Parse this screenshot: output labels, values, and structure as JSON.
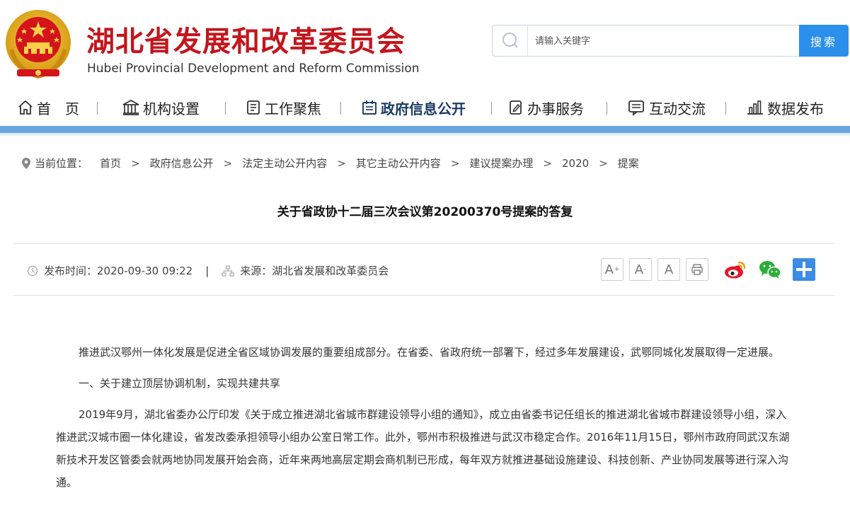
{
  "site": {
    "title": "湖北省发展和改革委员会",
    "subtitle": "Hubei Provincial Development and Reform Commission"
  },
  "search": {
    "placeholder": "请输入关键字",
    "button_label": "搜索"
  },
  "nav": {
    "items": [
      {
        "label": "首　页",
        "icon": "home-icon"
      },
      {
        "label": "机构设置",
        "icon": "building-icon"
      },
      {
        "label": "工作聚焦",
        "icon": "document-icon"
      },
      {
        "label": "政府信息公开",
        "icon": "calendar-icon",
        "active": true
      },
      {
        "label": "办事服务",
        "icon": "edit-icon"
      },
      {
        "label": "互动交流",
        "icon": "chat-icon"
      },
      {
        "label": "数据发布",
        "icon": "bar-chart-icon"
      }
    ]
  },
  "breadcrumb": {
    "label": "当前位置：",
    "items": [
      "首页",
      "政府信息公开",
      "法定主动公开内容",
      "其它主动公开内容",
      "建议提案办理",
      "2020",
      "提案"
    ],
    "separator": ">"
  },
  "article": {
    "title": "关于省政协十二届三次会议第20200370号提案的答复",
    "publish_label": "发布时间：",
    "publish_time": "2020-09-30 09:22",
    "meta_separator": "|",
    "source_label": "来源：",
    "source": "湖北省发展和改革委员会",
    "paragraphs": [
      "推进武汉鄂州一体化发展是促进全省区域协调发展的重要组成部分。在省委、省政府统一部署下，经过多年发展建设，武鄂同城化发展取得一定进展。",
      "一、关于建立顶层协调机制，实现共建共享",
      "2019年9月，湖北省委办公厅印发《关于成立推进湖北省城市群建设领导小组的通知》，成立由省委书记任组长的推进湖北省城市群建设领导小组，深入推进武汉城市圈一体化建设，省发改委承担领导小组办公室日常工作。此外，鄂州市积极推进与武汉市稳定合作。2016年11月15日，鄂州市政府同武汉东湖新技术开发区管委会就两地协同发展开始会商，近年来两地高层定期会商机制已形成，每年双方就推进基础设施建设、科技创新、产业协同发展等进行深入沟通。"
    ]
  },
  "tools": {
    "font_larger": "A",
    "font_smaller": "A",
    "font_default": "A",
    "plus_sign": "+",
    "minus_sign": "-"
  },
  "colors": {
    "brand_red": "#c4161c",
    "accent_blue": "#2b8fec",
    "nav_bar": "#6aa7e2",
    "nav_active": "#1b3c66"
  }
}
